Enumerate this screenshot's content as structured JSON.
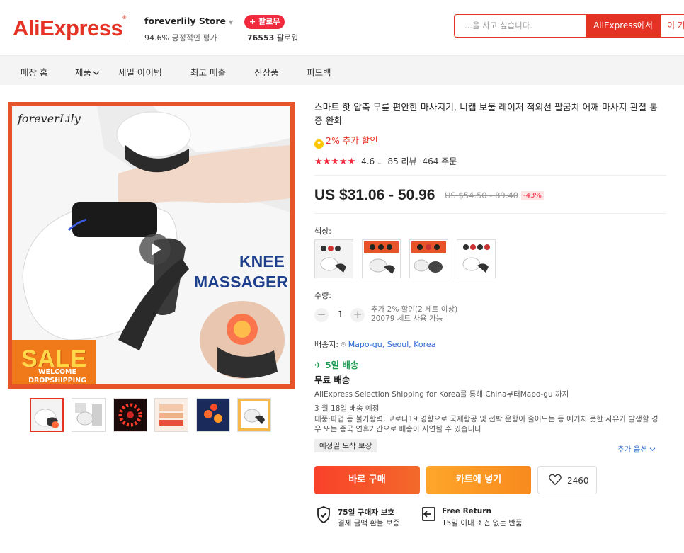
{
  "header": {
    "logo": "AliExpress",
    "logo_tm": "®",
    "store_name": "foreverlily Store",
    "store_rating_value": "94.6%",
    "store_rating_label": "긍정적인 평가",
    "follow_label": "+ 팔로우",
    "followers_count": "76553",
    "followers_label": "팔로워",
    "search_placeholder": "...을 사고 싶습니다.",
    "search_btn": "AliExpress에서",
    "search_btn2": "이 가"
  },
  "nav": {
    "items": [
      "매장 홈",
      "제품",
      "세일 아이템",
      "최고 매출",
      "신상품",
      "피드백"
    ]
  },
  "gallery": {
    "brand": "foreverLily",
    "headline_1": "KNEE",
    "headline_2": "MASSAGER",
    "sale": "SALE",
    "sale_sub_1": "WELCOME",
    "sale_sub_2": "DROPSHIPPING"
  },
  "product": {
    "title": "스마트 핫 압축 무릎 편안한 마사지기, 니캡 보물 레이저 적외선 팔꿈치 어깨 마사지 관절 통증 완화",
    "extra_discount": "2% 추가 할인",
    "stars": "★★★★★",
    "rating": "4.6",
    "reviews": "85 리뷰",
    "orders": "464 주문",
    "price": "US $31.06 - 50.96",
    "old_price": "US $54.50 - 89.40",
    "discount_pct": "-43%",
    "color_label": "색상:",
    "qty_label": "수량:",
    "qty_value": "1",
    "qty_note_1": "추가 2% 할인(2 세트 이상)",
    "qty_note_2": "20079 세트 사용 가능",
    "ship_to_label": "배송지:",
    "ship_to_value": "Mapo-gu, Seoul, Korea",
    "delivery_days": "5일 배송",
    "free_shipping": "무료 배송",
    "ship_desc": "AliExpress Selection Shipping for Korea를 통해 China부터Mapo-gu 까지",
    "ship_date": "3 월 18일 배송 예정",
    "ship_warning": "태풍·파업 등 불가항력, 코로나19 영향으로 국제항공 및 선박 운항이 줄어드는 등 예기치 못한 사유가 발생할 경우 또는 중국 연휴기간으로 배송이 지연될 수 있습니다",
    "guarantee": "예정일 도착 보장",
    "more_options": "추가 옵션",
    "buy_now": "바로 구매",
    "add_cart": "카트에 넣기",
    "wishlist_count": "2460",
    "protection_title": "75일 구매자 보호",
    "protection_sub": "결제 금액 환불 보증",
    "return_title": "Free Return",
    "return_sub": "15일 이내 조건 없는 반품"
  },
  "colors": {
    "brand": "#e43225",
    "price_red": "#f12a3e",
    "green": "#1e9b53",
    "link": "#2e6ad1",
    "buy": "#f9412a",
    "cart": "#fea62b"
  }
}
